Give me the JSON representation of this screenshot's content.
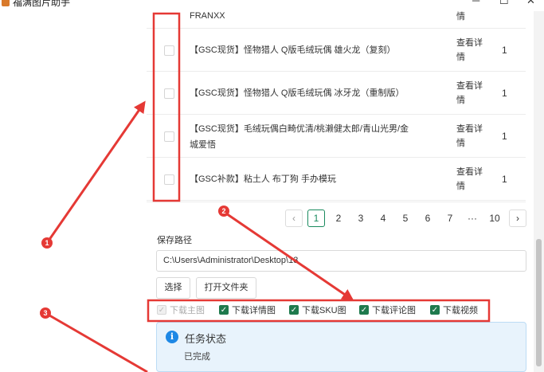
{
  "window": {
    "title": "福满图片助手",
    "minimize_glyph": "─",
    "maximize_glyph": "☐",
    "close_glyph": "✕"
  },
  "top_row": {
    "name_fragment": "FRANXX",
    "detail_fragment": "情"
  },
  "products": [
    {
      "name": "【GSC现货】怪物猎人 Q版毛绒玩偶 雄火龙（复刻）",
      "detail_line1": "查看详",
      "detail_line2": "情",
      "qty": "1"
    },
    {
      "name": "【GSC现货】怪物猎人 Q版毛绒玩偶 冰牙龙（重制版）",
      "detail_line1": "查看详",
      "detail_line2": "情",
      "qty": "1"
    },
    {
      "name_line1": "【GSC现货】毛绒玩偶白畸优清/桃濑健太郎/青山光男/金",
      "name_line2": "城爱悟",
      "detail_line1": "查看详",
      "detail_line2": "情",
      "qty": "1"
    },
    {
      "name": "【GSC补款】粘土人 布丁狗 手办模玩",
      "detail_line1": "查看详",
      "detail_line2": "情",
      "qty": "1"
    }
  ],
  "pagination": {
    "prev": "‹",
    "next": "›",
    "pages": [
      "1",
      "2",
      "3",
      "4",
      "5",
      "6",
      "7",
      "···",
      "10"
    ],
    "current": "1"
  },
  "save": {
    "label": "保存路径",
    "path": "C:\\Users\\Administrator\\Desktop\\13",
    "select_button": "选择",
    "open_folder_button": "打开文件夹"
  },
  "download_options": [
    {
      "label": "下载主图",
      "checked": true,
      "disabled": true
    },
    {
      "label": "下载详情图",
      "checked": true,
      "disabled": false
    },
    {
      "label": "下载SKU图",
      "checked": true,
      "disabled": false
    },
    {
      "label": "下载评论图",
      "checked": true,
      "disabled": false
    },
    {
      "label": "下载视频",
      "checked": true,
      "disabled": false
    }
  ],
  "task_status": {
    "title": "任务状态",
    "text": "已完成",
    "icon": "info-icon"
  },
  "annotations": {
    "badges": [
      "1",
      "2",
      "3"
    ],
    "color": "#e53935"
  },
  "colors": {
    "accent": "#1f7a4d",
    "info_bg": "#e8f3fc",
    "annotation_red": "#e53935"
  }
}
